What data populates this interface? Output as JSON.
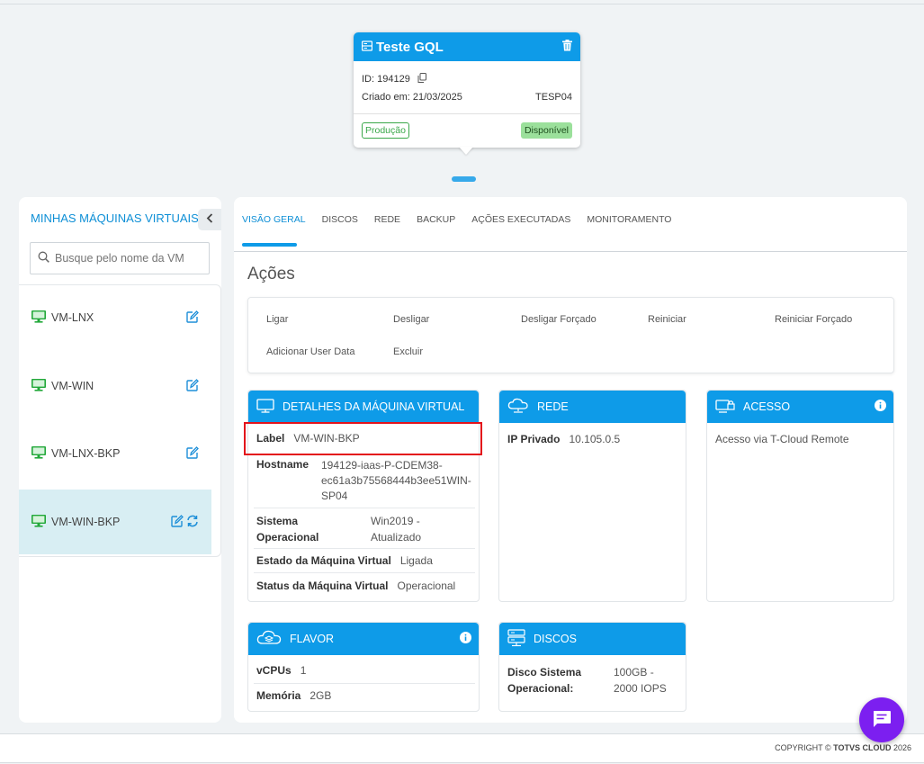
{
  "node": {
    "title": "Teste GQL",
    "id_label": "ID: 194129",
    "created": "Criado em: 21/03/2025",
    "location": "TESP04",
    "env_badge": "Produção",
    "status_badge": "Disponível"
  },
  "sidebar": {
    "title": "MINHAS MÁQUINAS VIRTUAIS",
    "search_placeholder": "Busque pelo nome da VM",
    "items": [
      {
        "name": "VM-LNX"
      },
      {
        "name": "VM-WIN"
      },
      {
        "name": "VM-LNX-BKP"
      },
      {
        "name": "VM-WIN-BKP",
        "active": true
      }
    ]
  },
  "tabs": [
    "VISÃO GERAL",
    "DISCOS",
    "REDE",
    "BACKUP",
    "AÇÕES EXECUTADAS",
    "MONITORAMENTO"
  ],
  "acoes": {
    "title": "Ações",
    "items": [
      "Ligar",
      "Desligar",
      "Desligar Forçado",
      "Reiniciar",
      "Reiniciar Forçado",
      "Adicionar User Data",
      "Excluir"
    ]
  },
  "details": {
    "title": "DETALHES DA MÁQUINA VIRTUAL",
    "label_k": "Label",
    "label_v": "VM-WIN-BKP",
    "hostname_k": "Hostname",
    "hostname_v1": "194129-iaas-P-CDEM38-",
    "hostname_v2": "ec61a3b75568444b3ee51WIN-",
    "hostname_v3": "SP04",
    "so_k1": "Sistema",
    "so_k2": "Operacional",
    "so_v1": "Win2019 -",
    "so_v2": "Atualizado",
    "estado_k": "Estado da Máquina Virtual",
    "estado_v": "Ligada",
    "status_k": "Status da Máquina Virtual",
    "status_v": "Operacional"
  },
  "rede": {
    "title": "REDE",
    "ip_k": "IP Privado",
    "ip_v": "10.105.0.5"
  },
  "acesso": {
    "title": "ACESSO",
    "text": "Acesso via T-Cloud Remote"
  },
  "flavor": {
    "title": "FLAVOR",
    "vcpu_k": "vCPUs",
    "vcpu_v": "1",
    "mem_k": "Memória",
    "mem_v": "2GB"
  },
  "discos": {
    "title": "DISCOS",
    "k1": "Disco Sistema",
    "k2": "Operacional:",
    "v1": "100GB -",
    "v2": "2000 IOPS"
  },
  "footer": {
    "prefix": "COPYRIGHT © ",
    "brand": "TOTVS CLOUD",
    "year": " 2026"
  },
  "colors": {
    "accent": "#0e9be8",
    "chat": "#7c1ff0",
    "vm_icon": "#22a83a",
    "highlight": "#e3131b"
  }
}
